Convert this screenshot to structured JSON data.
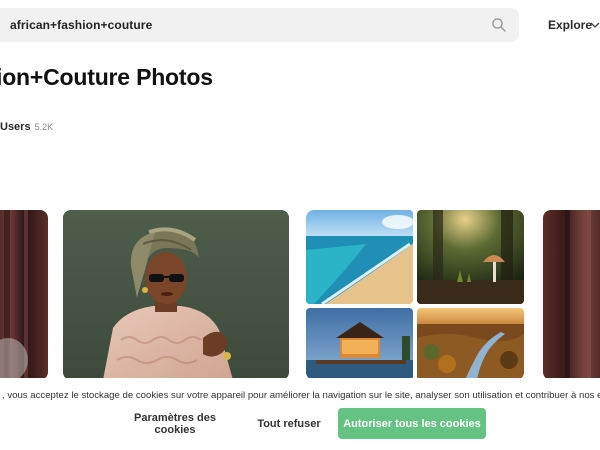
{
  "search": {
    "value": "african+fashion+couture"
  },
  "nav": {
    "explore_label": "Explore"
  },
  "page": {
    "title": "ion+Couture Photos"
  },
  "filter": {
    "label": "Users",
    "count": "5.2K"
  },
  "cookie": {
    "message": ", vous acceptez le stockage de cookies sur votre appareil pour améliorer la navigation sur le site, analyser son utilisation et contribuer à nos ef",
    "settings_label": "Paramètres des cookies",
    "refuse_label": "Tout refuser",
    "accept_label": "Autoriser tous les cookies"
  },
  "colors": {
    "accent": "#64c283",
    "search_bg": "#f1f1f1"
  },
  "icons": {
    "search": "search-icon",
    "explore": "chevron-down-icon"
  }
}
